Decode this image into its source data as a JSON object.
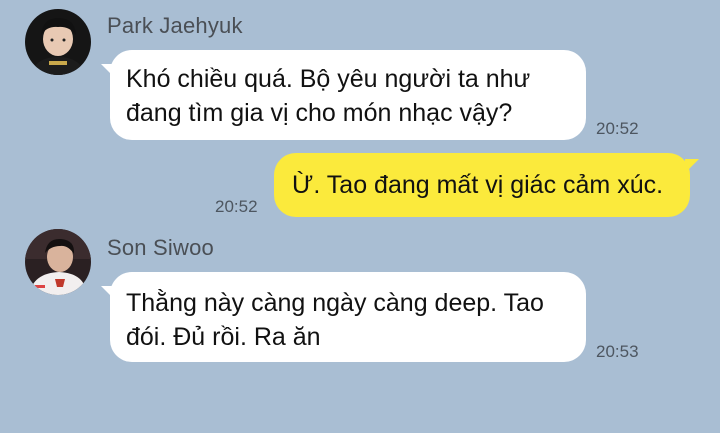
{
  "messages": [
    {
      "sender": "Park Jaehyuk",
      "avatar_icon": "profile-photo-park-jaehyuk",
      "lines": [
        "Khó chiều quá. Bộ yêu người ta như",
        "đang tìm gia vị cho món nhạc vậy?"
      ],
      "time": "20:52"
    },
    {
      "sender": "me",
      "lines": [
        "Ừ. Tao đang mất vị giác cảm xúc."
      ],
      "time": "20:52"
    },
    {
      "sender": "Son Siwoo",
      "avatar_icon": "profile-photo-son-siwoo",
      "lines": [
        "Thằng này càng ngày càng deep. Tao",
        "đói. Đủ rồi. Ra ăn"
      ],
      "time": "20:53"
    }
  ],
  "colors": {
    "background": "#a9bed3",
    "incoming_bubble": "#ffffff",
    "outgoing_bubble": "#fbea3c"
  }
}
